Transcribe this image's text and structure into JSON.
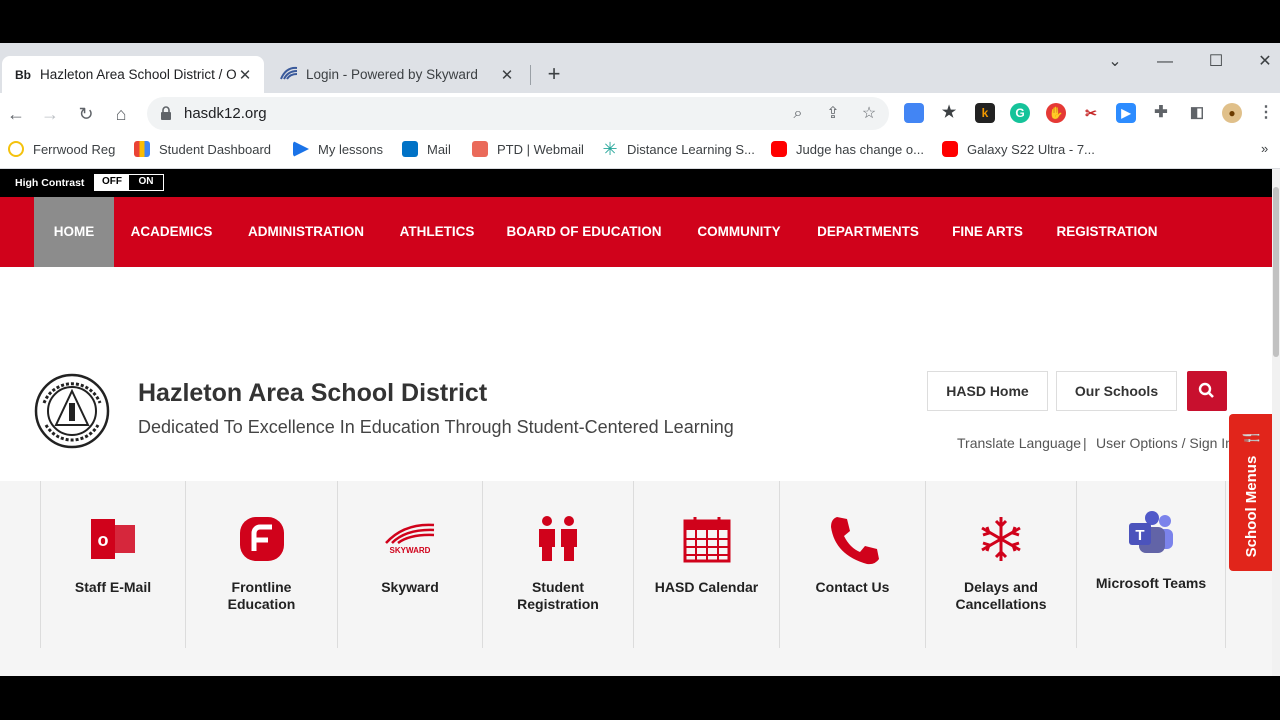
{
  "browser": {
    "tabs": [
      {
        "favicon": "Bb",
        "title": "Hazleton Area School District / O",
        "active": true
      },
      {
        "favicon": "skyward-icon",
        "title": "Login - Powered by Skyward",
        "active": false
      }
    ],
    "url": "hasdk12.org",
    "bookmarks": [
      {
        "label": "Ferrwood Reg",
        "color": "#f4c20d"
      },
      {
        "label": "Student Dashboard",
        "color": "#f29900"
      },
      {
        "label": "My lessons",
        "color": "#1a73e8"
      },
      {
        "label": "Mail",
        "color": "#0072c6"
      },
      {
        "label": "PTD | Webmail",
        "color": "#ea4335"
      },
      {
        "label": "Distance Learning S...",
        "color": "#26a69a"
      },
      {
        "label": "Judge has change o...",
        "color": "#ff0000"
      },
      {
        "label": "Galaxy S22 Ultra - 7...",
        "color": "#ff0000"
      }
    ],
    "more_bookmarks": "»"
  },
  "site": {
    "high_contrast_label": "High Contrast",
    "toggle_off": "OFF",
    "toggle_on": "ON",
    "nav": [
      "HOME",
      "ACADEMICS",
      "ADMINISTRATION",
      "ATHLETICS",
      "BOARD OF EDUCATION",
      "COMMUNITY",
      "DEPARTMENTS",
      "FINE ARTS",
      "REGISTRATION"
    ],
    "district_name": "Hazleton Area School District",
    "tagline": "Dedicated To Excellence In Education Through Student-Centered Learning",
    "header_buttons": {
      "home": "HASD Home",
      "schools": "Our Schools"
    },
    "translate": "Translate Language",
    "separator": "|",
    "sign_in": "User Options / Sign In",
    "quick_links": [
      {
        "label": "Staff E-Mail",
        "icon": "outlook-icon"
      },
      {
        "label": "Frontline\nEducation",
        "icon": "frontline-icon"
      },
      {
        "label": "Skyward",
        "icon": "skyward-icon"
      },
      {
        "label": "Student\nRegistration",
        "icon": "students-icon"
      },
      {
        "label": "HASD Calendar",
        "icon": "calendar-icon"
      },
      {
        "label": "Contact Us",
        "icon": "phone-icon"
      },
      {
        "label": "Delays and\nCancellations",
        "icon": "snowflake-icon"
      },
      {
        "label": "Microsoft Teams",
        "icon": "teams-icon"
      }
    ],
    "school_menus": "School Menus",
    "accent_color": "#d0021b"
  }
}
